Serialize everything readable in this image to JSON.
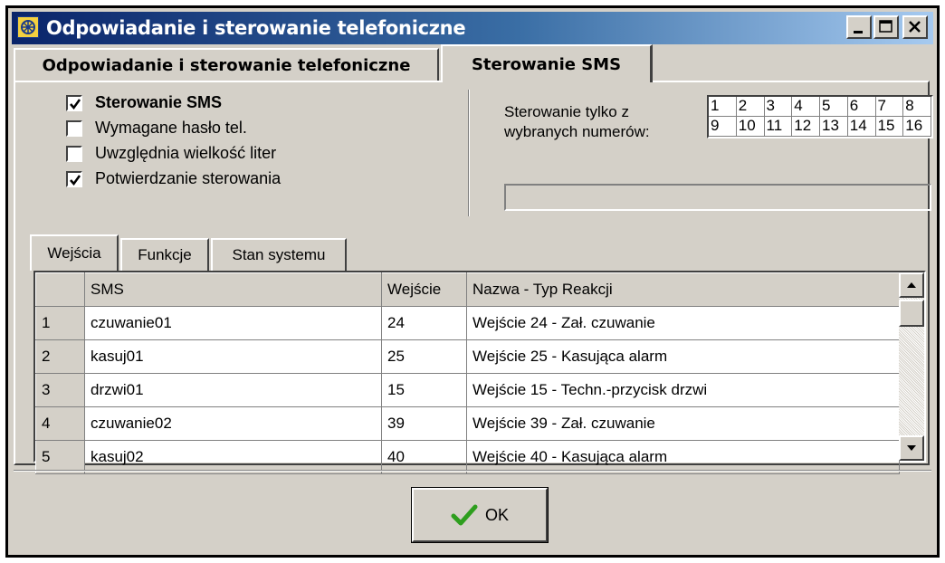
{
  "window": {
    "title": "Odpowiadanie i sterowanie telefoniczne"
  },
  "tabs": [
    {
      "label": "Odpowiadanie i sterowanie telefoniczne",
      "active": false
    },
    {
      "label": "Sterowanie SMS",
      "active": true
    }
  ],
  "options": {
    "checkboxes": [
      {
        "label": "Sterowanie SMS",
        "checked": true
      },
      {
        "label": "Wymagane hasło tel.",
        "checked": false
      },
      {
        "label": "Uwzględnia wielkość liter",
        "checked": false
      },
      {
        "label": "Potwierdzanie sterowania",
        "checked": true
      }
    ],
    "numbers_label": "Sterowanie tylko z\nwybranych numerów:",
    "numbers": [
      "1",
      "2",
      "3",
      "4",
      "5",
      "6",
      "7",
      "8",
      "9",
      "10",
      "11",
      "12",
      "13",
      "14",
      "15",
      "16"
    ]
  },
  "subtabs": [
    {
      "label": "Wejścia",
      "active": true
    },
    {
      "label": "Funkcje",
      "active": false
    },
    {
      "label": "Stan systemu",
      "active": false
    }
  ],
  "grid": {
    "columns": [
      "",
      "SMS",
      "Wejście",
      "Nazwa - Typ Reakcji"
    ],
    "rows": [
      [
        "1",
        "czuwanie01",
        "24",
        "Wejście  24 - Zał. czuwanie"
      ],
      [
        "2",
        "kasuj01",
        "25",
        "Wejście  25 - Kasująca alarm"
      ],
      [
        "3",
        "drzwi01",
        "15",
        "Wejście  15 - Techn.-przycisk drzwi"
      ],
      [
        "4",
        "czuwanie02",
        "39",
        "Wejście  39 - Zał. czuwanie"
      ],
      [
        "5",
        "kasuj02",
        "40",
        "Wejście  40 - Kasująca alarm"
      ]
    ]
  },
  "ok_button": {
    "label": "OK",
    "icon": "checkmark-icon",
    "icon_color": "#2e9e1e"
  },
  "colors": {
    "titlebar_start": "#0a246a",
    "titlebar_end": "#a6caf0",
    "face": "#d4d0c8"
  }
}
